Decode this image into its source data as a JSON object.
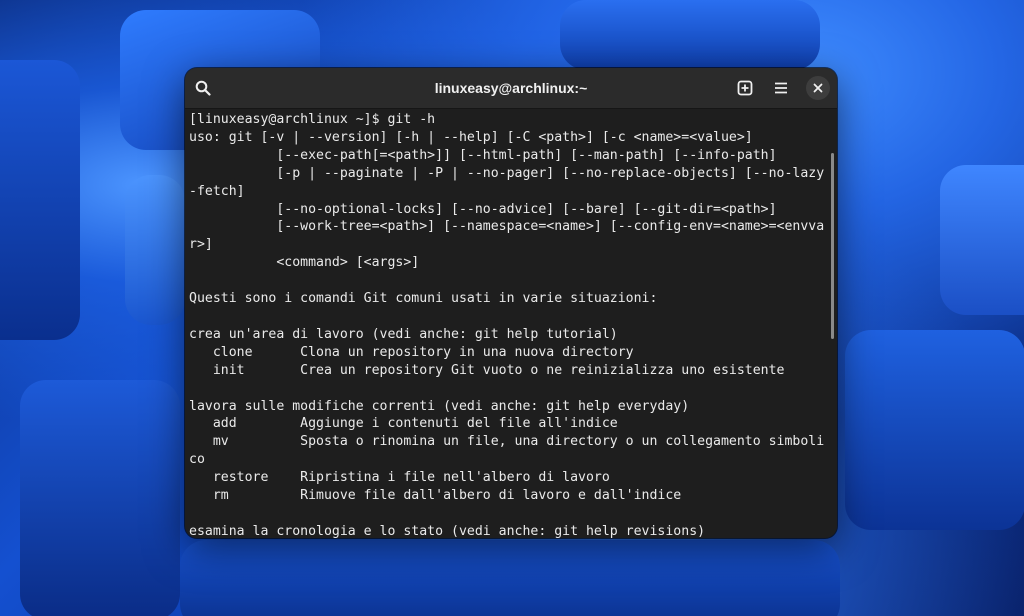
{
  "window": {
    "title": "linuxeasy@archlinux:~"
  },
  "titlebar": {
    "search_icon": "search-icon",
    "new_tab_icon": "new-tab-icon",
    "menu_icon": "hamburger-menu-icon",
    "close_icon": "close-icon"
  },
  "terminal": {
    "lines": [
      "[linuxeasy@archlinux ~]$ git -h",
      "uso: git [-v | --version] [-h | --help] [-C <path>] [-c <name>=<value>]",
      "           [--exec-path[=<path>]] [--html-path] [--man-path] [--info-path]",
      "           [-p | --paginate | -P | --no-pager] [--no-replace-objects] [--no-lazy",
      "-fetch]",
      "           [--no-optional-locks] [--no-advice] [--bare] [--git-dir=<path>]",
      "           [--work-tree=<path>] [--namespace=<name>] [--config-env=<name>=<envva",
      "r>]",
      "           <command> [<args>]",
      "",
      "Questi sono i comandi Git comuni usati in varie situazioni:",
      "",
      "crea un'area di lavoro (vedi anche: git help tutorial)",
      "   clone      Clona un repository in una nuova directory",
      "   init       Crea un repository Git vuoto o ne reinizializza uno esistente",
      "",
      "lavora sulle modifiche correnti (vedi anche: git help everyday)",
      "   add        Aggiunge i contenuti del file all'indice",
      "   mv         Sposta o rinomina un file, una directory o un collegamento simboli",
      "co",
      "   restore    Ripristina i file nell'albero di lavoro",
      "   rm         Rimuove file dall'albero di lavoro e dall'indice",
      "",
      "esamina la cronologia e lo stato (vedi anche: git help revisions)"
    ]
  },
  "colors": {
    "terminal_bg": "#1e1e1e",
    "titlebar_bg": "#2b2b2b",
    "text": "#eaeaea",
    "wallpaper_accent": "#1450d0"
  }
}
